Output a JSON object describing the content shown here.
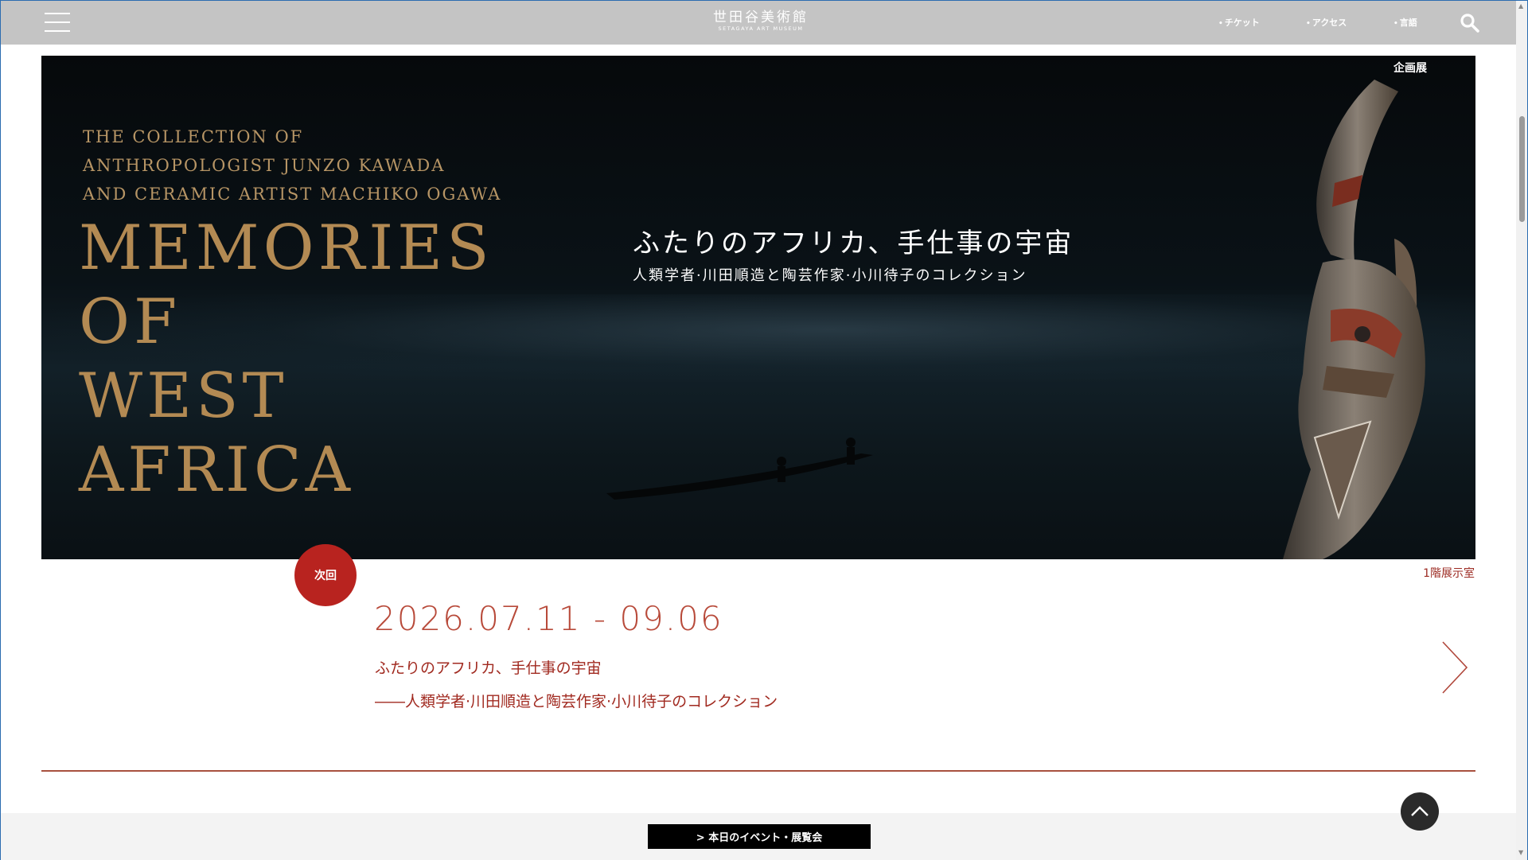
{
  "header": {
    "logo_jp": "世田谷美術館",
    "logo_en": "SETAGAYA ART MUSEUM",
    "nav": [
      {
        "label": "チケット"
      },
      {
        "label": "アクセス"
      },
      {
        "label": "言語"
      }
    ],
    "nav_bullet": "•"
  },
  "hero": {
    "tag": "企画展",
    "subtitle_en": [
      "THE COLLECTION OF",
      "ANTHROPOLOGIST JUNZO KAWADA",
      "AND CERAMIC ARTIST MACHIKO OGAWA"
    ],
    "title_en": [
      "MEMORIES",
      "OF",
      "WEST",
      "AFRICA"
    ],
    "title_jp": "ふたりのアフリカ、手仕事の宇宙",
    "subtitle_jp": "人類学者·川田順造と陶芸作家·小川待子のコレクション"
  },
  "exhibition": {
    "badge": "次回",
    "room": "1階展示室",
    "dates": "2026.07.11 - 09.06",
    "title": "ふたりのアフリカ、手仕事の宇宙",
    "subtitle": "――人類学者·川田順造と陶芸作家·小川待子のコレクション"
  },
  "bottom": {
    "today_button": "> 本日のイベント・展覧会"
  },
  "colors": {
    "header_bg": "#c4c4c4",
    "accent_red": "#b8231f",
    "hero_gold": "#b38a53"
  }
}
